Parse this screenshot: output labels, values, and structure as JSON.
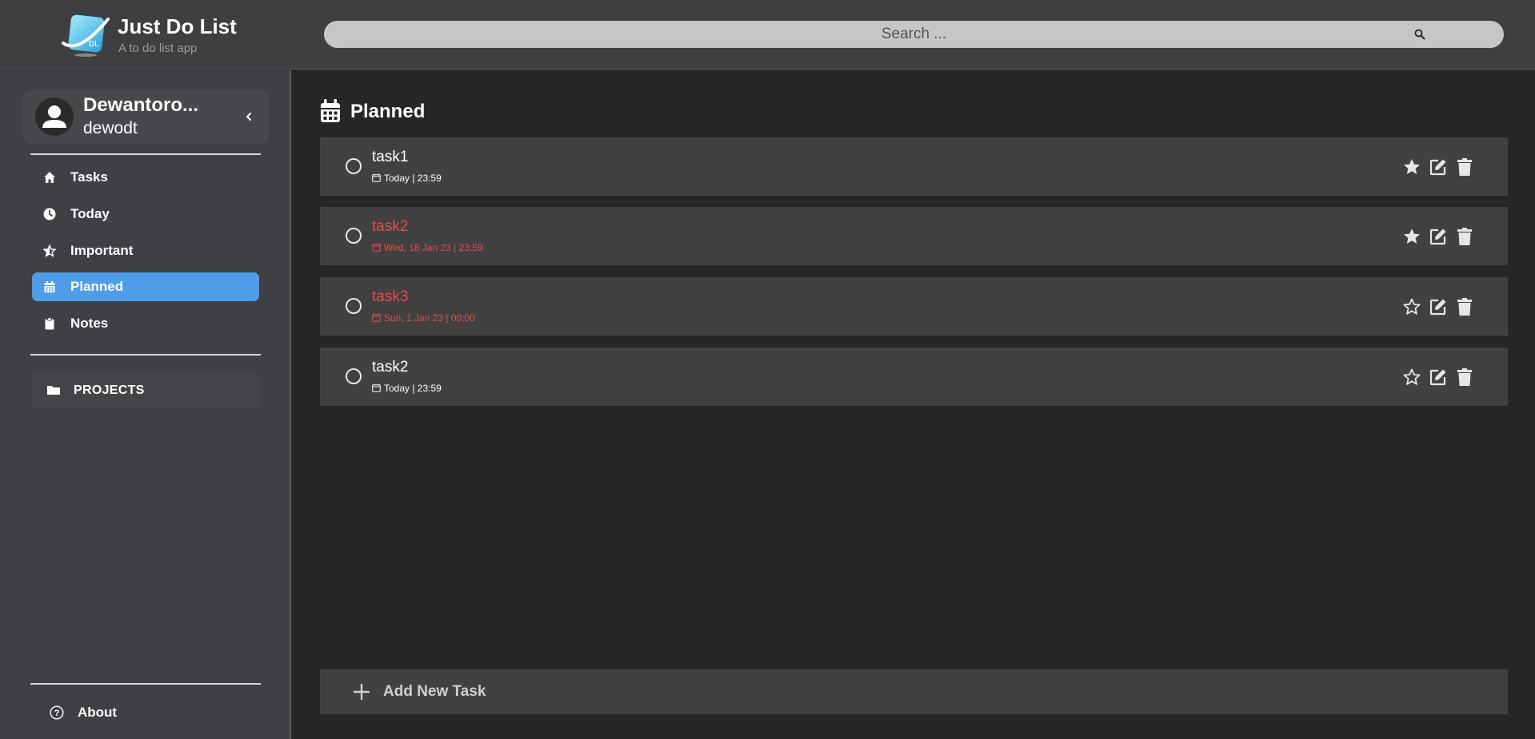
{
  "app": {
    "title": "Just Do List",
    "subtitle": "A to do list app",
    "logo_text": "DL"
  },
  "search": {
    "placeholder": "Search ...",
    "icon": "search-icon"
  },
  "profile": {
    "name": "Dewantoro...",
    "username": "dewodt"
  },
  "sidebar": {
    "items": [
      {
        "label": "Tasks",
        "icon": "home-icon",
        "active": false
      },
      {
        "label": "Today",
        "icon": "clock-icon",
        "active": false
      },
      {
        "label": "Important",
        "icon": "star-half-icon",
        "active": false
      },
      {
        "label": "Planned",
        "icon": "calendar-icon",
        "active": true
      },
      {
        "label": "Notes",
        "icon": "clipboard-icon",
        "active": false
      }
    ],
    "projects_label": "PROJECTS",
    "about_label": "About"
  },
  "main": {
    "title": "Planned",
    "tasks": [
      {
        "name": "task1",
        "due": "Today | 23:59",
        "overdue": false,
        "important": true
      },
      {
        "name": "task2",
        "due": "Wed, 18 Jan 23 | 23:59",
        "overdue": true,
        "important": true
      },
      {
        "name": "task3",
        "due": "Sun, 1 Jan 23 | 00:00",
        "overdue": true,
        "important": false
      },
      {
        "name": "task2",
        "due": "Today | 23:59",
        "overdue": false,
        "important": false
      }
    ],
    "add_task_label": "Add New Task"
  },
  "colors": {
    "accent": "#4f9de8",
    "overdue": "#e84a4a",
    "background": "#272727",
    "sidebar": "#3f3f44"
  }
}
